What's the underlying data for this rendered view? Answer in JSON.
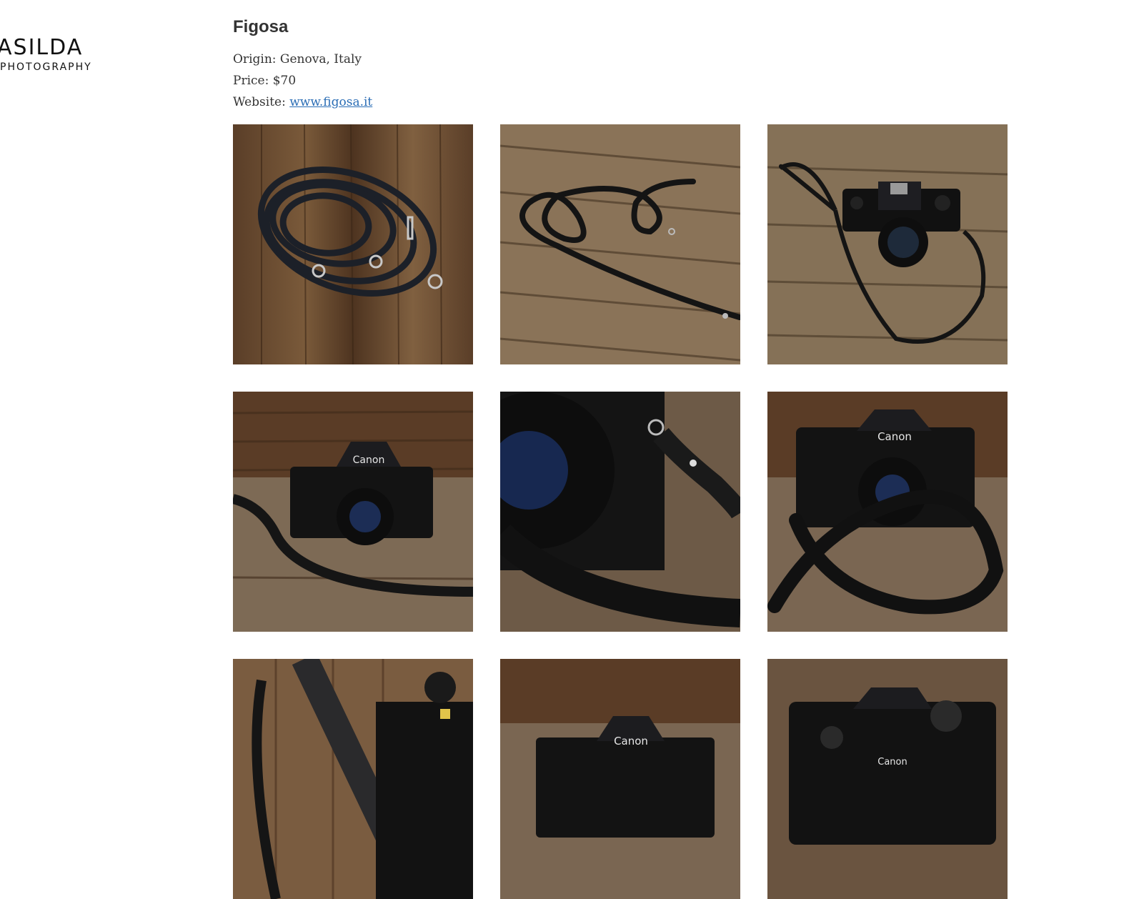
{
  "logo": {
    "main": "ASILDA",
    "sub": "PHOTOGRAPHY"
  },
  "product": {
    "title": "Figosa",
    "origin_label": "Origin: ",
    "origin_value": "Genova, Italy",
    "price_label": "Price: ",
    "price_value": "$70",
    "website_label": "Website: ",
    "website_link": "www.figosa.it"
  },
  "gallery": {
    "photos": [
      {
        "subject": "coiled-strap-on-wood"
      },
      {
        "subject": "strap-on-wood-planks"
      },
      {
        "subject": "camera-with-strap-top-view"
      },
      {
        "subject": "canon-camera-with-strap-front"
      },
      {
        "subject": "lens-closeup-with-strap"
      },
      {
        "subject": "camera-wrapped-in-strap"
      },
      {
        "subject": "strap-and-camera-top"
      },
      {
        "subject": "canon-camera-front-partial"
      },
      {
        "subject": "camera-top-dials-partial"
      }
    ]
  },
  "colors": {
    "link": "#2a6db5",
    "wood_dark": "#4a3220",
    "wood_light": "#8a6a4a",
    "strap": "#1a1a1c"
  }
}
